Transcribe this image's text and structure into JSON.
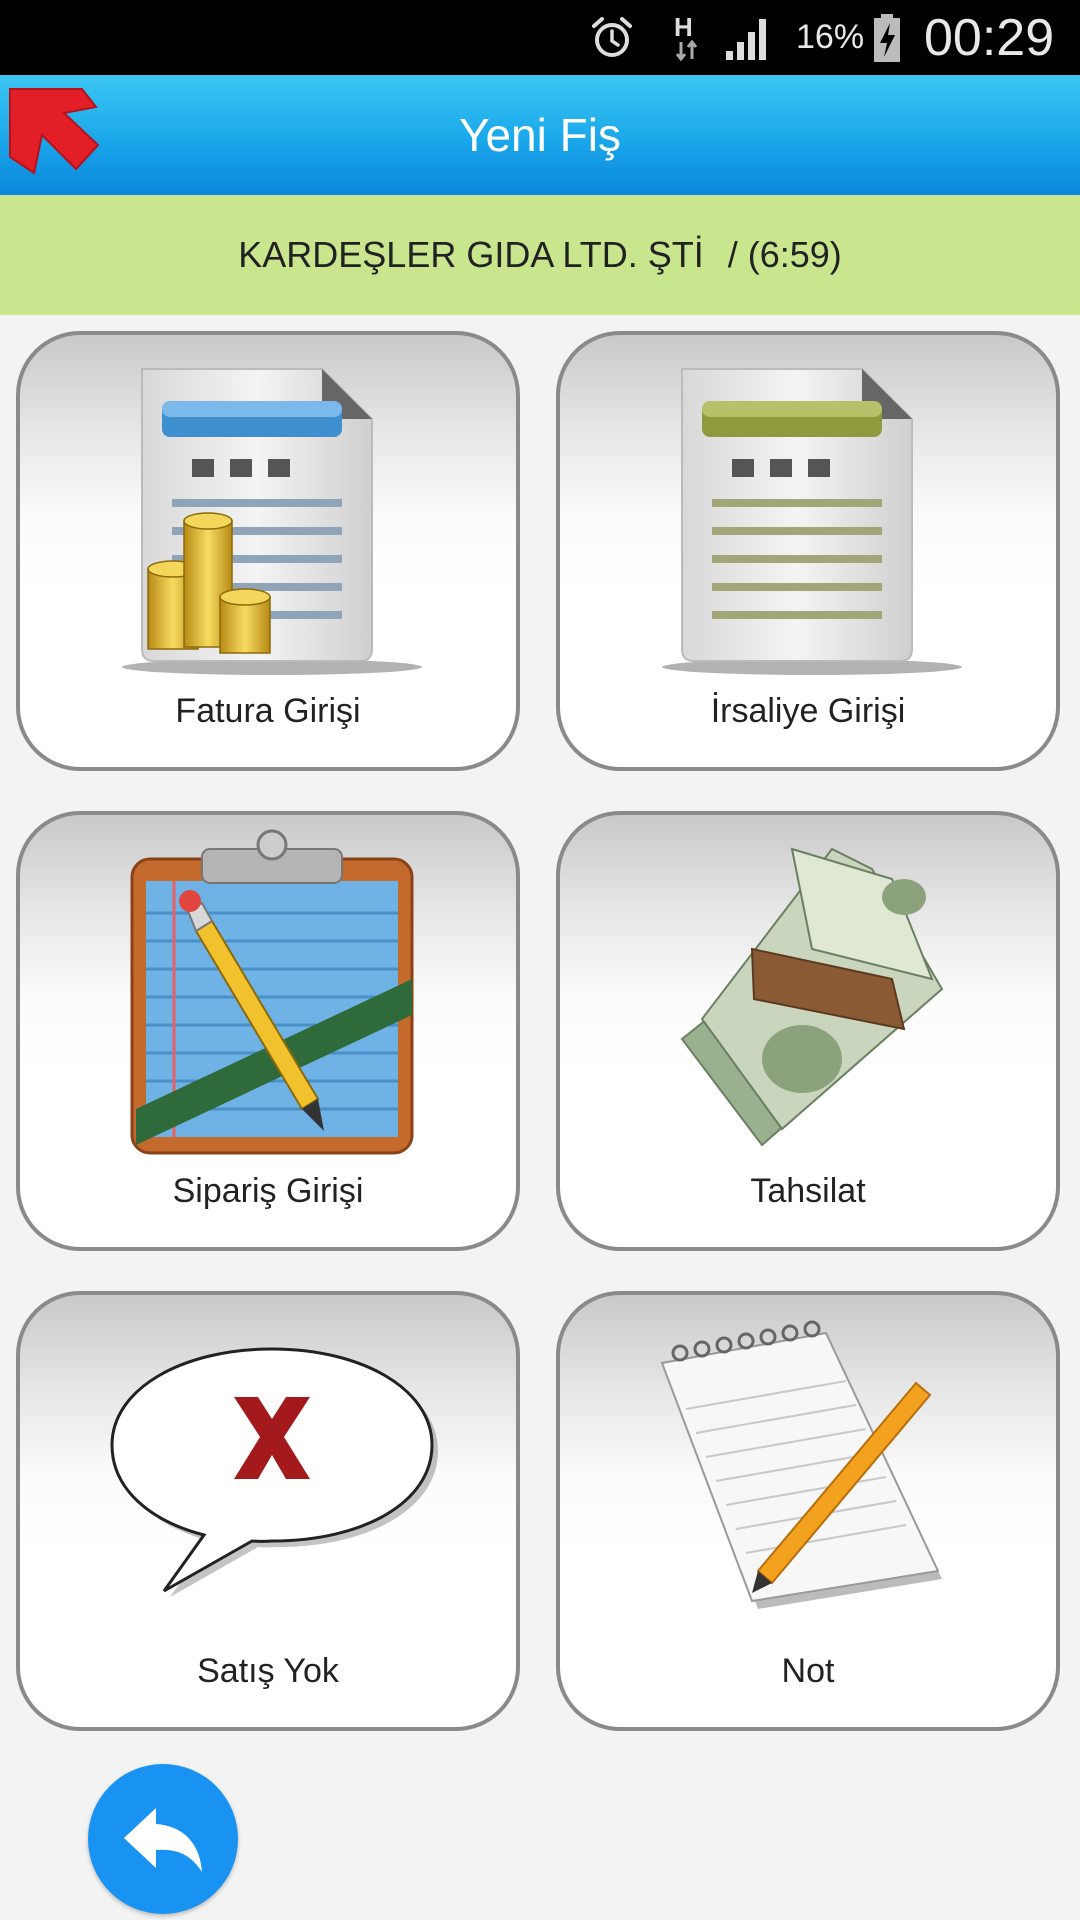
{
  "status_bar": {
    "battery_percent": "16%",
    "time": "00:29",
    "network_type": "H",
    "icons": [
      "alarm-icon",
      "network-h-icon",
      "signal-icon",
      "battery-charging-icon"
    ]
  },
  "app_bar": {
    "title": "Yeni Fiş",
    "logo_icon": "red-arrow-logo-icon"
  },
  "customer": {
    "name": "KARDEŞLER GIDA LTD. ŞTİ",
    "time": "/ (6:59)"
  },
  "tiles": [
    {
      "label": "Fatura Girişi",
      "icon": "invoice-coins-icon"
    },
    {
      "label": "İrsaliye Girişi",
      "icon": "waybill-document-icon"
    },
    {
      "label": "Sipariş Girişi",
      "icon": "clipboard-pencil-icon"
    },
    {
      "label": "Tahsilat",
      "icon": "money-stack-icon"
    },
    {
      "label": "Satış Yok",
      "icon": "speech-bubble-x-icon"
    },
    {
      "label": "Not",
      "icon": "notepad-pencil-icon"
    }
  ],
  "fab": {
    "icon": "reply-arrow-icon"
  },
  "colors": {
    "status_bar": "#000000",
    "app_bar": "#1aa7ea",
    "customer_strip": "#c9e68f",
    "fab": "#1993f2",
    "tile_border": "#8a8a8a"
  }
}
